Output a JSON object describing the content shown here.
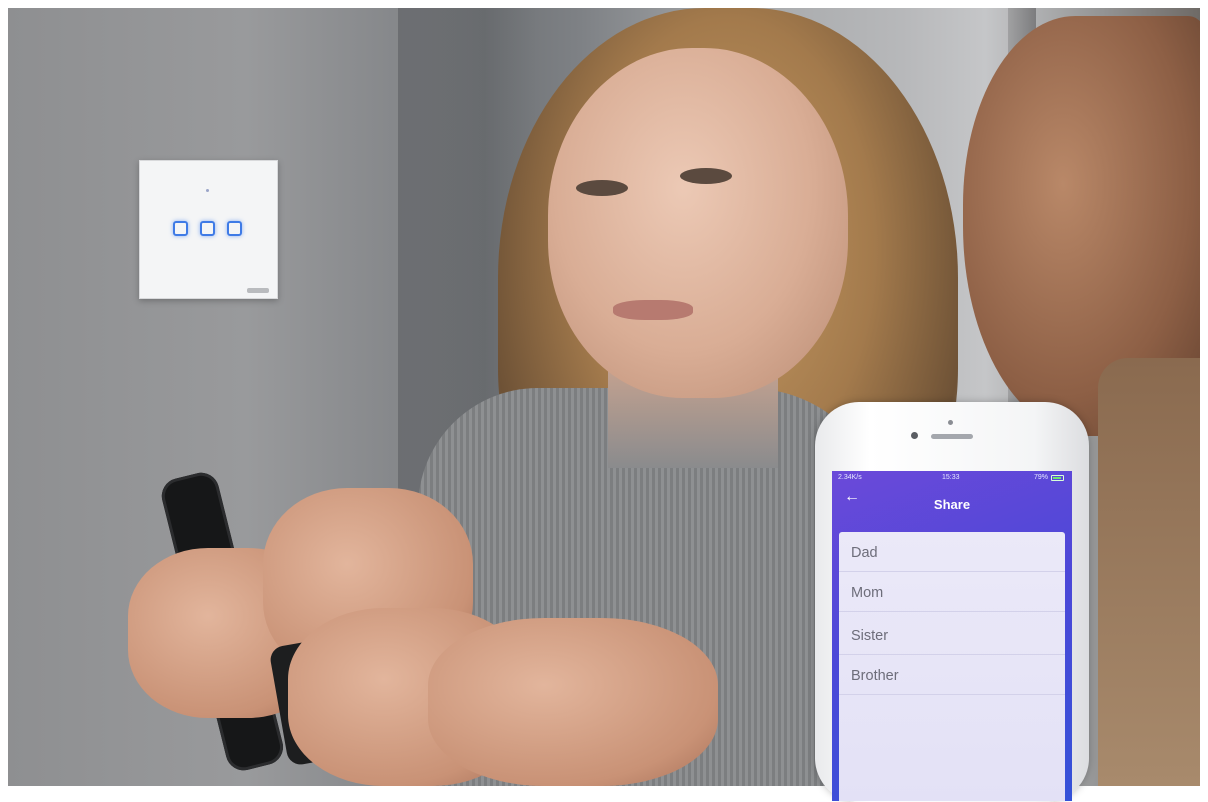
{
  "phone_app": {
    "status_bar": {
      "network": "2.34K/s",
      "time": "15:33",
      "battery": "79%"
    },
    "back_icon": "back-arrow-icon",
    "title": "Share",
    "contacts": [
      "Dad",
      "Mom",
      "Sister",
      "Brother"
    ]
  },
  "colors": {
    "header_gradient_start": "#6b49d9",
    "header_gradient_end": "#3552d8",
    "switch_led": "#3f7be6"
  }
}
